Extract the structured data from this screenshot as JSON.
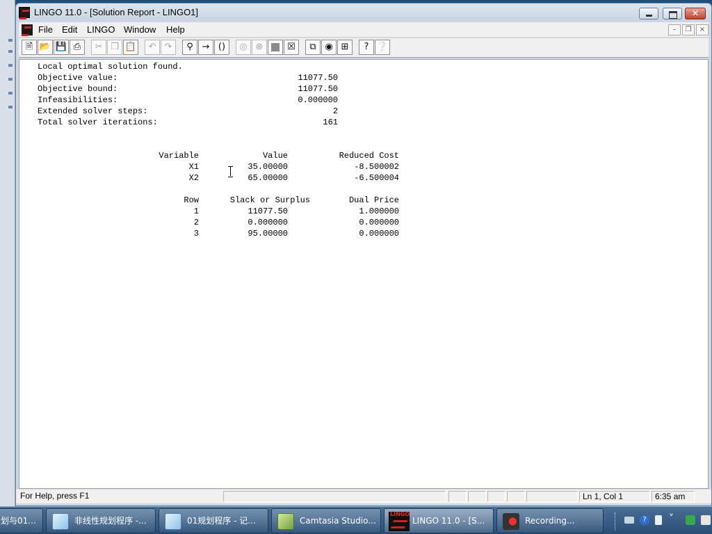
{
  "window": {
    "title": "LINGO 11.0 - [Solution Report - LINGO1]"
  },
  "menu": {
    "items": [
      "File",
      "Edit",
      "LINGO",
      "Window",
      "Help"
    ]
  },
  "report": {
    "summary": [
      {
        "label": "Local optimal solution found.",
        "value": ""
      },
      {
        "label": "Objective value:",
        "value": "11077.50"
      },
      {
        "label": "Objective bound:",
        "value": "11077.50"
      },
      {
        "label": "Infeasibilities:",
        "value": "0.000000"
      },
      {
        "label": "Extended solver steps:",
        "value": "2"
      },
      {
        "label": "Total solver iterations:",
        "value": "161"
      }
    ],
    "variables_table": {
      "headers": [
        "Variable",
        "Value",
        "Reduced Cost"
      ],
      "rows": [
        [
          "X1",
          "35.00000",
          "-8.500002"
        ],
        [
          "X2",
          "65.00000",
          "-6.500004"
        ]
      ]
    },
    "rows_table": {
      "headers": [
        "Row",
        "Slack or Surplus",
        "Dual Price"
      ],
      "rows": [
        [
          "1",
          "11077.50",
          "1.000000"
        ],
        [
          "2",
          "0.000000",
          "0.000000"
        ],
        [
          "3",
          "95.00000",
          "0.000000"
        ]
      ]
    }
  },
  "status": {
    "help": "For Help, press F1",
    "position": "Ln 1, Col 1",
    "time": "6:35 am"
  },
  "taskbar": {
    "tasks": [
      {
        "label": "划与01...",
        "icon": "notepad-icon"
      },
      {
        "label": "非线性规划程序 -...",
        "icon": "notepad-icon"
      },
      {
        "label": "01规划程序 - 记...",
        "icon": "notepad-icon"
      },
      {
        "label": "Camtasia Studio...",
        "icon": "camtasia-icon"
      },
      {
        "label": "LINGO 11.0 - [S...",
        "icon": "lingo-icon"
      },
      {
        "label": "Recording...",
        "icon": "record-icon"
      }
    ],
    "lingo_icon_text": "LINGO"
  }
}
